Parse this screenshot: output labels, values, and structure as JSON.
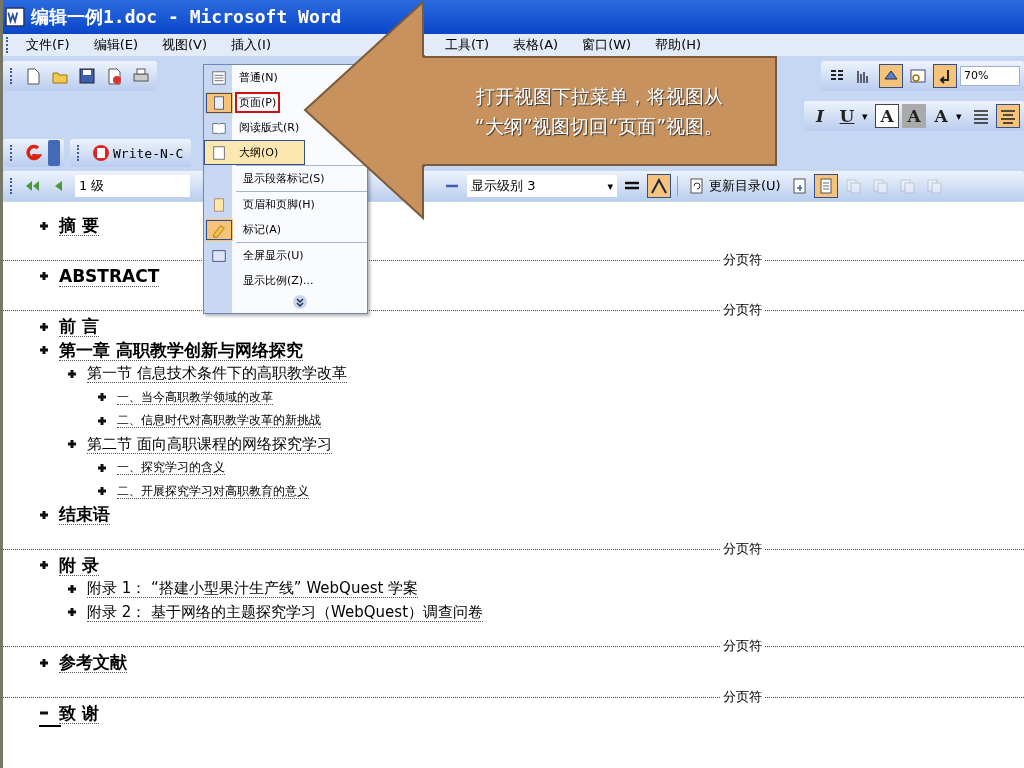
{
  "window": {
    "title": "编辑一例1.doc - Microsoft Word"
  },
  "menu_bar": [
    {
      "label": "文件(F)"
    },
    {
      "label": "编辑(E)"
    },
    {
      "label": "视图(V)"
    },
    {
      "label": "插入(I)"
    },
    {
      "label": "工具(T)"
    },
    {
      "label": "表格(A)"
    },
    {
      "label": "窗口(W)"
    },
    {
      "label": "帮助(H)"
    }
  ],
  "standard_toolbar": {
    "left": [
      {
        "kind": "new",
        "active": false
      },
      {
        "kind": "open",
        "active": false
      },
      {
        "kind": "save",
        "active": false
      },
      {
        "kind": "permission",
        "active": false
      },
      {
        "kind": "print",
        "active": false
      }
    ],
    "right": [
      {
        "kind": "columns",
        "active": false
      },
      {
        "kind": "chart",
        "active": false
      },
      {
        "kind": "drawing",
        "active": true
      },
      {
        "kind": "document-map",
        "active": false
      },
      {
        "kind": "show-hide",
        "active": true
      }
    ],
    "zoom": "70%"
  },
  "formatting_toolbar": [
    {
      "kind": "italic",
      "label": "I",
      "active": false
    },
    {
      "kind": "underline",
      "label": "U",
      "active": false
    },
    {
      "kind": "caret",
      "symbol": "▾",
      "active": false
    },
    {
      "kind": "char-border",
      "label": "A",
      "active": false
    },
    {
      "kind": "char-shading",
      "label": "A",
      "active": false
    },
    {
      "kind": "text-effects",
      "label": "A",
      "active": false
    },
    {
      "kind": "caret",
      "symbol": "▾",
      "active": false
    },
    {
      "kind": "justify",
      "active": false
    },
    {
      "kind": "distributed",
      "active": true
    }
  ],
  "addin_toolbar": {
    "button": {
      "label": "Write-N-C"
    }
  },
  "outline_toolbar": {
    "level": "1 级",
    "show_level": {
      "text": "显示级别 3",
      "arrow": "▾"
    },
    "update_toc": "更新目录(U)",
    "tools": [
      {
        "kind": "first-line",
        "active": false,
        "disabled": false
      },
      {
        "kind": "formatting",
        "active": true,
        "disabled": false
      }
    ],
    "view_tools": [
      {
        "kind": "goto-toc",
        "active": false,
        "disabled": false
      },
      {
        "kind": "master-doc",
        "active": true,
        "disabled": false
      },
      {
        "kind": "subdoc",
        "active": false,
        "disabled": true
      },
      {
        "kind": "subdoc",
        "active": false,
        "disabled": true
      },
      {
        "kind": "subdoc",
        "active": false,
        "disabled": true
      },
      {
        "kind": "subdoc",
        "active": false,
        "disabled": true
      }
    ]
  },
  "view_menu": [
    {
      "label": "普通(N)",
      "kind": "normal",
      "selected": false,
      "checked": false,
      "emphasized": false,
      "separator_before": false
    },
    {
      "label": "页面(P)",
      "kind": "page",
      "selected": false,
      "checked": true,
      "emphasized": true,
      "separator_before": false
    },
    {
      "label": "阅读版式(R)",
      "kind": "reading",
      "selected": false,
      "checked": false,
      "emphasized": false,
      "separator_before": false
    },
    {
      "label": "大纲(O)",
      "kind": "outline",
      "selected": true,
      "checked": false,
      "emphasized": false,
      "separator_before": false
    },
    {
      "label": "显示段落标记(S)",
      "kind": "none",
      "selected": false,
      "checked": false,
      "emphasized": false,
      "separator_before": true
    },
    {
      "label": "页眉和页脚(H)",
      "kind": "header",
      "selected": false,
      "checked": false,
      "emphasized": false,
      "separator_before": true
    },
    {
      "label": "标记(A)",
      "kind": "markup",
      "selected": false,
      "checked": true,
      "emphasized": false,
      "separator_before": false
    },
    {
      "label": "全屏显示(U)",
      "kind": "fullscreen",
      "selected": false,
      "checked": false,
      "emphasized": false,
      "separator_before": true
    },
    {
      "label": "显示比例(Z)...",
      "kind": "none",
      "selected": false,
      "checked": false,
      "emphasized": false,
      "separator_before": false
    }
  ],
  "callout": {
    "lines": [
      "打开视图下拉菜单，将视图从",
      "“大纲”视图切回“页面”视图。"
    ]
  },
  "outline": [
    {
      "text": "摘 要",
      "has_subtext": true,
      "page_break": "分页符"
    },
    {
      "text": "ABSTRACT",
      "has_subtext": true,
      "page_break": "分页符"
    },
    {
      "text": "前  言",
      "has_subtext": true
    },
    {
      "text": "第一章  高职教学创新与网络探究",
      "has_subtext": true,
      "children": [
        {
          "text": "第一节  信息技术条件下的高职教学改革",
          "has_subtext": true,
          "children": [
            {
              "text": "一、当今高职教学领域的改革",
              "has_subtext": true
            },
            {
              "text": "二、信息时代对高职教学改革的新挑战",
              "has_subtext": true
            }
          ]
        },
        {
          "text": "第二节  面向高职课程的网络探究学习",
          "has_subtext": true,
          "children": [
            {
              "text": "一、探究学习的含义",
              "has_subtext": true
            },
            {
              "text": "二、开展探究学习对高职教育的意义",
              "has_subtext": true
            }
          ]
        }
      ]
    },
    {
      "text": "结束语",
      "has_subtext": true,
      "page_break": "分页符"
    },
    {
      "text": "附  录",
      "has_subtext": true,
      "page_break": "分页符",
      "children": [
        {
          "text": "附录 1：  “搭建小型果汁生产线” WebQuest 学案",
          "has_subtext": true
        },
        {
          "text": "附录 2：  基于网络的主题探究学习（WebQuest）调查问卷",
          "has_subtext": true
        }
      ]
    },
    {
      "text": "参考文献",
      "has_subtext": true,
      "page_break": "分页符"
    },
    {
      "text": "致 谢",
      "has_subtext": false
    }
  ]
}
